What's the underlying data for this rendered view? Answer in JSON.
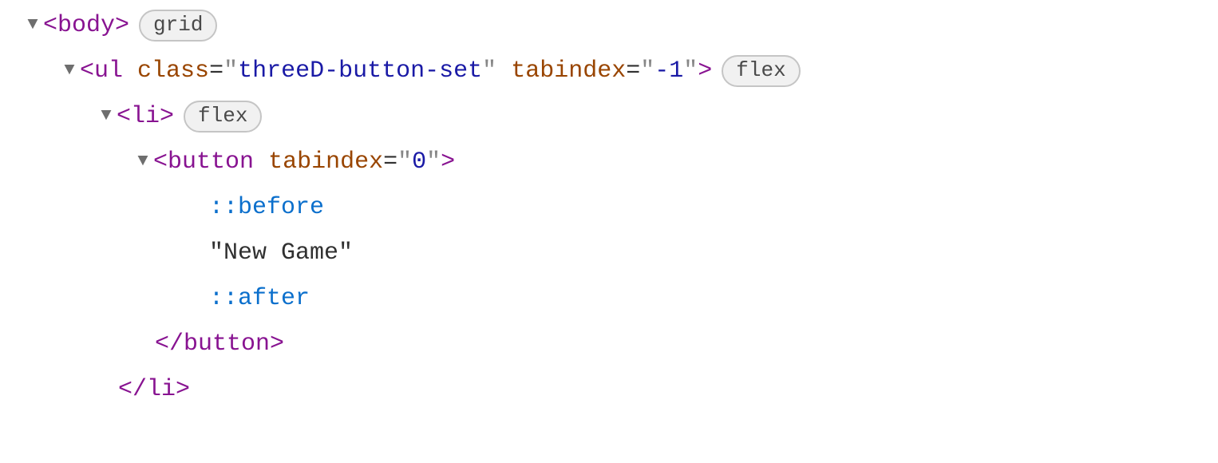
{
  "line0": {
    "tag": "body",
    "badge": "grid"
  },
  "line1": {
    "tag": "ul",
    "attr1_name": "class",
    "attr1_value": "threeD-button-set",
    "attr2_name": "tabindex",
    "attr2_value": "-1",
    "badge": "flex"
  },
  "line2": {
    "tag": "li",
    "badge": "flex"
  },
  "line3": {
    "tag": "button",
    "attr1_name": "tabindex",
    "attr1_value": "0"
  },
  "line4": {
    "pseudo": "::before"
  },
  "line5": {
    "text": "\"New Game\""
  },
  "line6": {
    "pseudo": "::after"
  },
  "line7": {
    "tag": "button"
  },
  "line8": {
    "tag": "li"
  }
}
